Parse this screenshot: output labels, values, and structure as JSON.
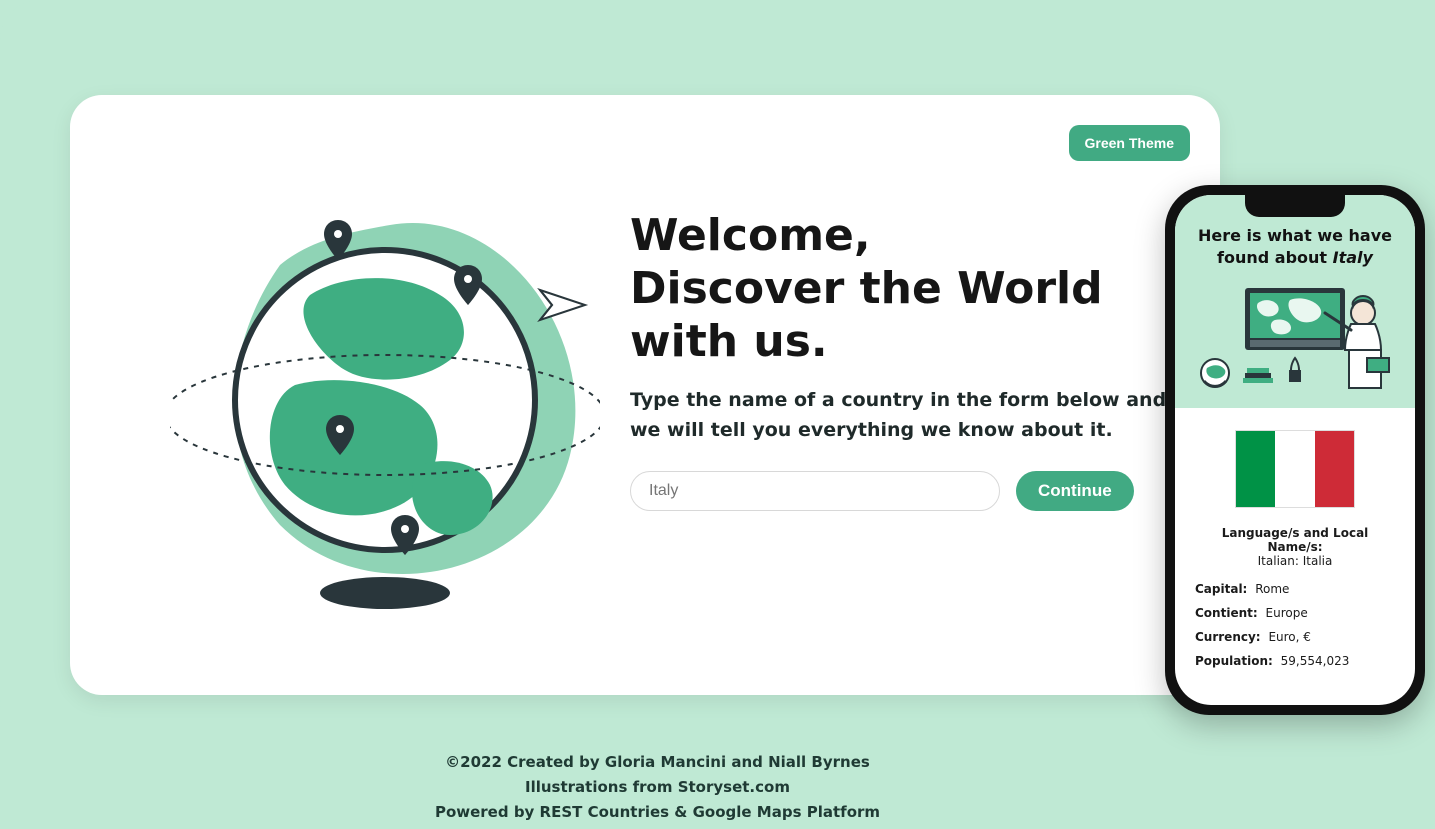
{
  "theme_button": "Green Theme",
  "hero": {
    "heading_line1": "Welcome,",
    "heading_line2": "Discover the World with us.",
    "description": "Type the name of a country in the form below and we will tell you everything we know about it.",
    "input_placeholder": "Italy",
    "continue_label": "Continue"
  },
  "phone": {
    "heading_prefix": "Here is what we have found about ",
    "heading_country": "Italy",
    "languages_label": "Language/s and Local Name/s:",
    "languages_value": "Italian: Italia",
    "capital_label": "Capital:",
    "capital_value": "Rome",
    "continent_label": "Contient:",
    "continent_value": "Europe",
    "currency_label": "Currency:",
    "currency_value": "Euro, €",
    "population_label": "Population:",
    "population_value": "59,554,023"
  },
  "footer": {
    "line1": "©2022 Created by Gloria Mancini and Niall Byrnes",
    "line2": "Illustrations from Storyset.com",
    "line3": "Powered by REST Countries & Google Maps Platform"
  },
  "colors": {
    "accent": "#41aa83",
    "bg": "#bfe9d4"
  }
}
